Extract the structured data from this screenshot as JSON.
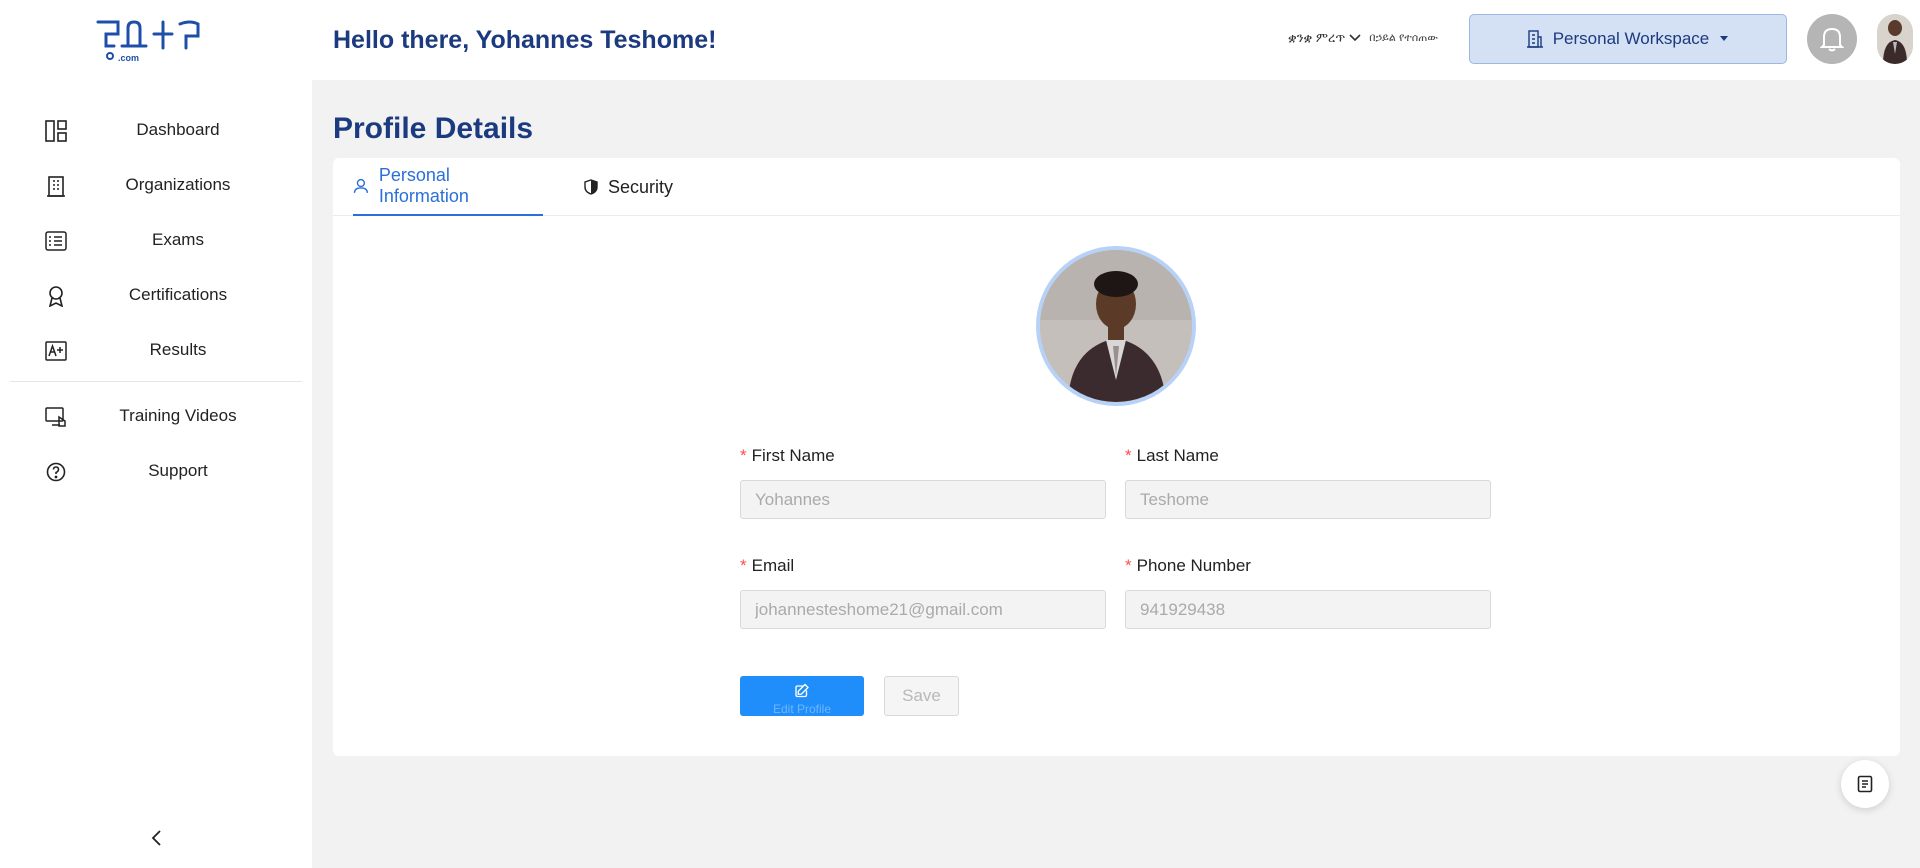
{
  "header": {
    "greeting": "Hello there, Yohannes Teshome!",
    "language_label": "ቋንቋ ምረጥ",
    "language_sub": "በኃይል የተሰጠው",
    "workspace_label": "Personal Workspace"
  },
  "sidebar": {
    "items": [
      {
        "label": "Dashboard",
        "icon": "dashboard-icon"
      },
      {
        "label": "Organizations",
        "icon": "building-icon"
      },
      {
        "label": "Exams",
        "icon": "exam-icon"
      },
      {
        "label": "Certifications",
        "icon": "award-icon"
      },
      {
        "label": "Results",
        "icon": "results-icon"
      },
      {
        "label": "Training Videos",
        "icon": "video-icon"
      },
      {
        "label": "Support",
        "icon": "help-icon"
      }
    ]
  },
  "main": {
    "title": "Profile Details",
    "tabs": [
      {
        "label": "Personal Information",
        "active": true
      },
      {
        "label": "Security",
        "active": false
      }
    ],
    "form": {
      "first_name_label": "First Name",
      "first_name_value": "Yohannes",
      "last_name_label": "Last Name",
      "last_name_value": "Teshome",
      "email_label": "Email",
      "email_value": "johannesteshome21@gmail.com",
      "phone_label": "Phone Number",
      "phone_value": "941929438",
      "required_mark": "*"
    },
    "buttons": {
      "edit_label": "Edit Profile",
      "save_label": "Save"
    }
  },
  "colors": {
    "brand": "#1c3a7f",
    "accent": "#1f8efa",
    "tab_active": "#2a70d8",
    "workspace_bg": "#d4e0f3"
  }
}
